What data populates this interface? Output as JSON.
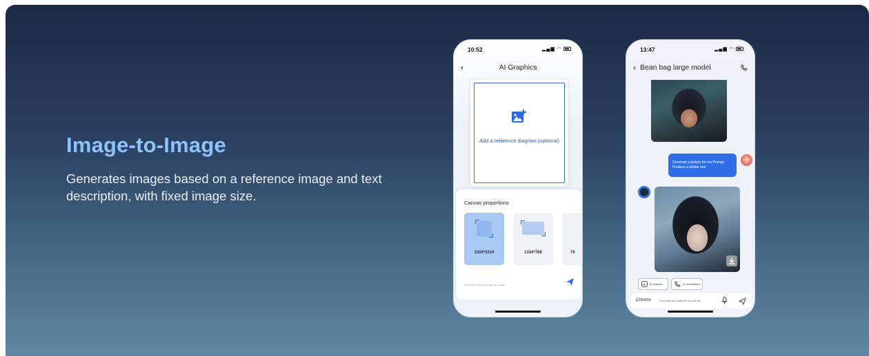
{
  "hero": {
    "title": "Image-to-Image",
    "description": "Generates images based on a reference image and text description, with fixed image size."
  },
  "phone_left": {
    "status_time": "10:52",
    "nav_title": "AI Graphics",
    "reference_label": "Add a reference diagram (optional)",
    "canvas_title": "Canvas proportions",
    "options": [
      "1024*1024",
      "1334*768",
      "76"
    ],
    "selected_option": "1024*1024",
    "prompt_placeholder": "Describe what you want to create"
  },
  "phone_right": {
    "status_time": "13:47",
    "nav_title": "Bean bag large model",
    "user_message": "Generate a picture for me Prompt: Produce a similar one",
    "chip_1": "AI Graphics",
    "chip_2": "AI conversations",
    "language": "Chinese",
    "input_placeholder": "If you have any questions, just ask me~"
  },
  "colors": {
    "headline": "#8ec3ff",
    "accent": "#2e6fe8"
  }
}
